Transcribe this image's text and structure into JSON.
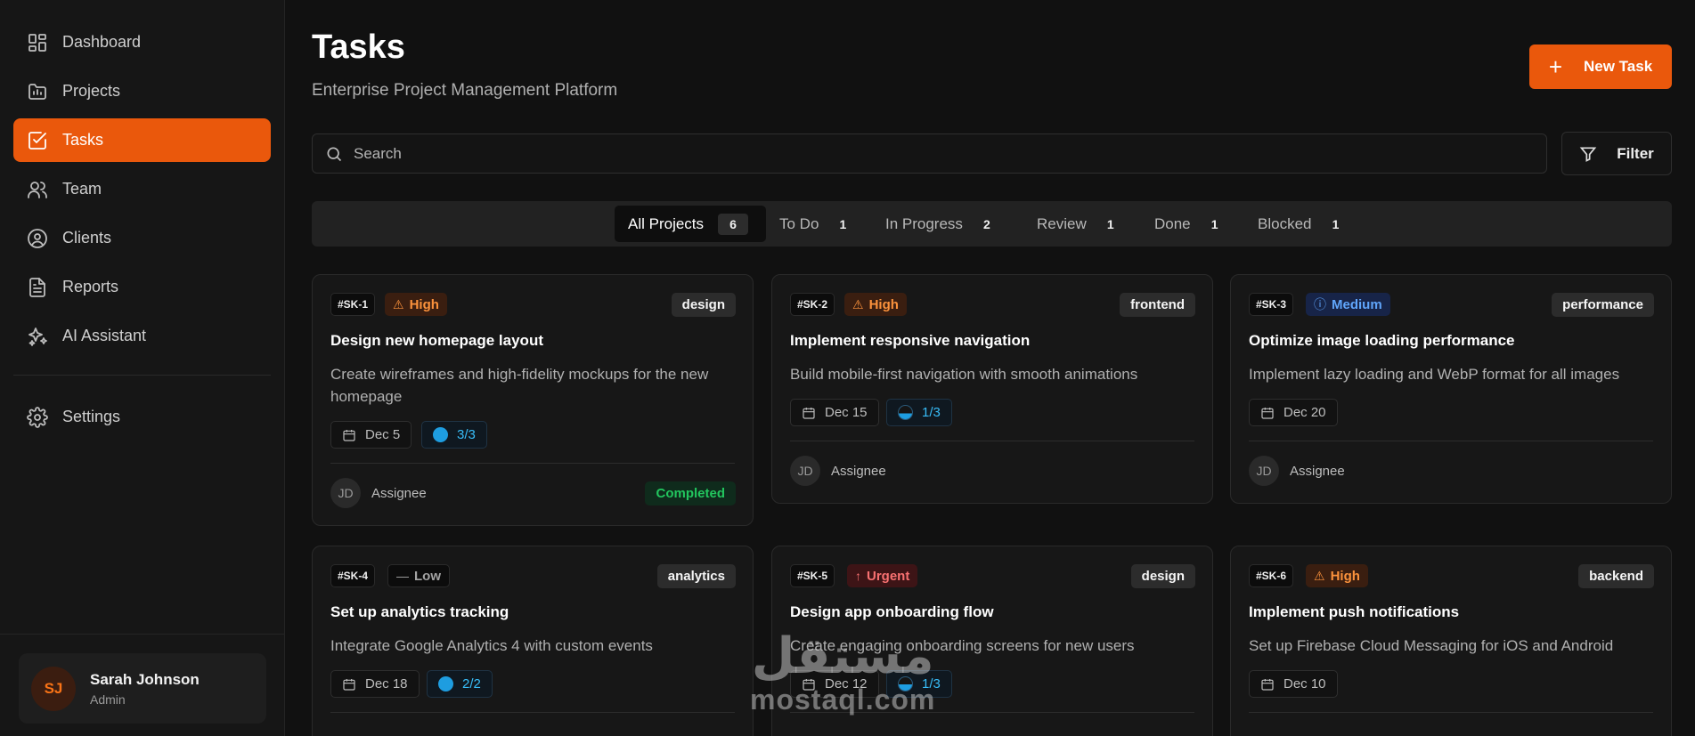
{
  "sidebar": {
    "items": [
      {
        "label": "Dashboard",
        "icon": "grid-icon"
      },
      {
        "label": "Projects",
        "icon": "folder-icon"
      },
      {
        "label": "Tasks",
        "icon": "checkbox-icon",
        "active": true
      },
      {
        "label": "Team",
        "icon": "users-icon"
      },
      {
        "label": "Clients",
        "icon": "user-circle-icon"
      },
      {
        "label": "Reports",
        "icon": "document-icon"
      },
      {
        "label": "AI Assistant",
        "icon": "sparkles-icon"
      }
    ],
    "settings": {
      "label": "Settings",
      "icon": "gear-icon"
    },
    "user": {
      "initials": "SJ",
      "name": "Sarah Johnson",
      "role": "Admin"
    }
  },
  "header": {
    "title": "Tasks",
    "subtitle": "Enterprise Project Management Platform",
    "new_task_label": "New Task"
  },
  "search": {
    "placeholder": "Search"
  },
  "filter": {
    "label": "Filter"
  },
  "tabs": [
    {
      "label": "All Projects",
      "count": "6",
      "active": true
    },
    {
      "label": "To Do",
      "count": "1"
    },
    {
      "label": "In Progress",
      "count": "2"
    },
    {
      "label": "Review",
      "count": "1"
    },
    {
      "label": "Done",
      "count": "1"
    },
    {
      "label": "Blocked",
      "count": "1"
    }
  ],
  "cards": [
    {
      "id": "#SK-1",
      "priority": "High",
      "tag": "design",
      "title": "Design new homepage layout",
      "description": "Create wireframes and high-fidelity mockups for the new homepage",
      "date": "Dec 5",
      "subtasks": "3/3",
      "assignee_initials": "JD",
      "assignee": "Assignee",
      "status": "Completed"
    },
    {
      "id": "#SK-2",
      "priority": "High",
      "tag": "frontend",
      "title": "Implement responsive navigation",
      "description": "Build mobile-first navigation with smooth animations",
      "date": "Dec 15",
      "subtasks": "1/3",
      "assignee_initials": "JD",
      "assignee": "Assignee"
    },
    {
      "id": "#SK-3",
      "priority": "Medium",
      "tag": "performance",
      "title": "Optimize image loading performance",
      "description": "Implement lazy loading and WebP format for all images",
      "date": "Dec 20",
      "assignee_initials": "JD",
      "assignee": "Assignee"
    },
    {
      "id": "#SK-4",
      "priority": "Low",
      "tag": "analytics",
      "title": "Set up analytics tracking",
      "description": "Integrate Google Analytics 4 with custom events",
      "date": "Dec 18",
      "subtasks": "2/2"
    },
    {
      "id": "#SK-5",
      "priority": "Urgent",
      "tag": "design",
      "title": "Design app onboarding flow",
      "description": "Create engaging onboarding screens for new users",
      "date": "Dec 12",
      "subtasks": "1/3"
    },
    {
      "id": "#SK-6",
      "priority": "High",
      "tag": "backend",
      "title": "Implement push notifications",
      "description": "Set up Firebase Cloud Messaging for iOS and Android",
      "date": "Dec 10"
    }
  ],
  "watermark": {
    "arabic": "مستقل",
    "latin": "mostaql.com"
  },
  "colors": {
    "accent": "#ea580c",
    "background": "#111111",
    "success": "#22c55e",
    "info": "#38bdf8"
  }
}
